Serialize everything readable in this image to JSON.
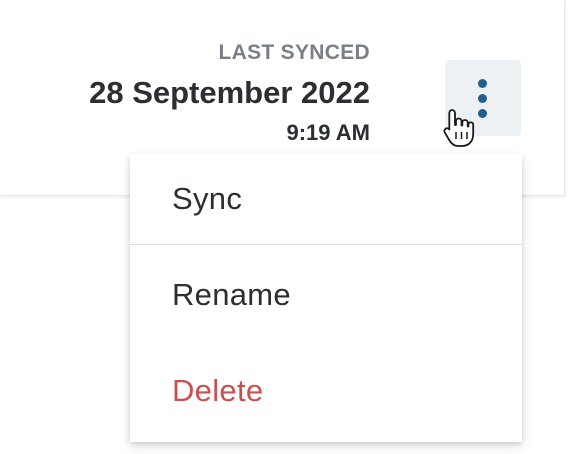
{
  "card": {
    "last_synced_label": "LAST SYNCED",
    "date": "28 September 2022",
    "time": "9:19 AM",
    "actions_icon": "vertical-ellipsis-icon"
  },
  "menu": {
    "items": [
      {
        "label": "Sync",
        "color": "#2b2f33"
      },
      {
        "label": "Rename",
        "color": "#2b2f33"
      },
      {
        "label": "Delete",
        "color": "#c9504f"
      }
    ]
  },
  "colors": {
    "accent": "#1f5f8f",
    "danger": "#c9504f",
    "text": "#2b2f33",
    "muted": "#7a7f86",
    "button_bg": "#eef1f4"
  },
  "cursor": {
    "icon": "hand-pointer-cursor-icon"
  }
}
